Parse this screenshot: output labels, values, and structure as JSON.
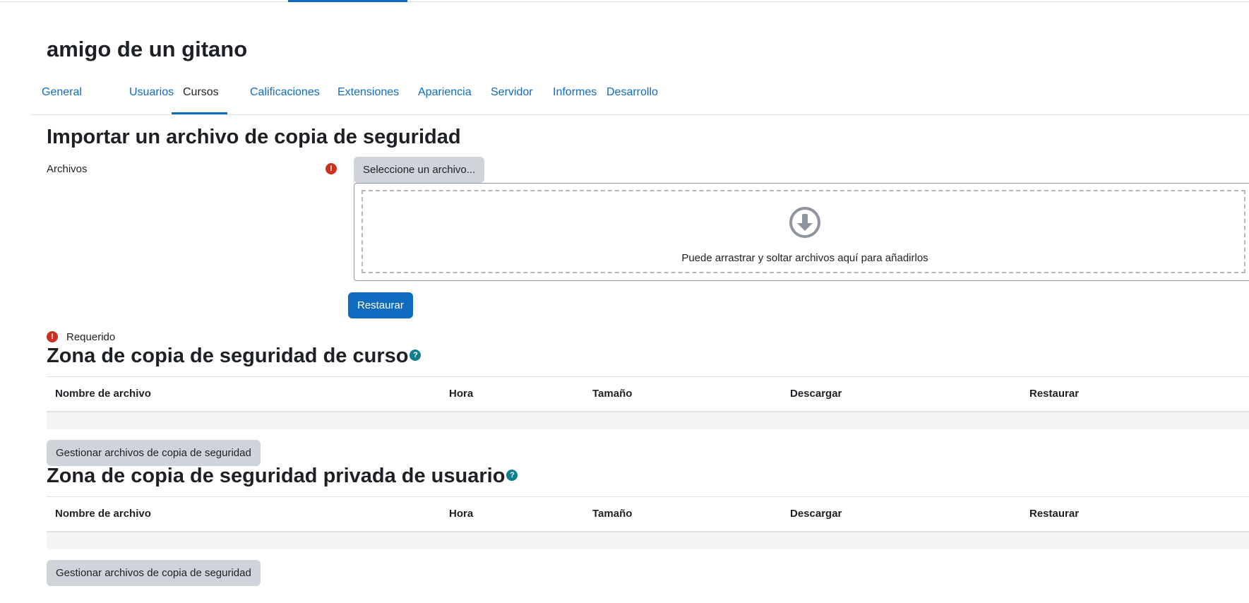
{
  "page": {
    "title": "amigo de un gitano"
  },
  "nav_tabs": [
    {
      "label": "General"
    },
    {
      "label": "Usuarios"
    },
    {
      "label": "Cursos"
    },
    {
      "label": "Calificaciones"
    },
    {
      "label": "Extensiones"
    },
    {
      "label": "Apariencia"
    },
    {
      "label": "Servidor"
    },
    {
      "label": "Informes"
    },
    {
      "label": "Desarrollo"
    }
  ],
  "active_tab": "Cursos",
  "import": {
    "heading": "Importar un archivo de copia de seguridad",
    "files_label": "Archivos",
    "required_icon": "!",
    "choose_button": "Seleccione un archivo...",
    "drop_text": "Puede arrastrar y soltar archivos aquí para añadirlos",
    "restore_button": "Restaurar",
    "required_text": "Requerido"
  },
  "course_zone": {
    "heading": "Zona de copia de seguridad de curso",
    "help_icon": "?",
    "columns": [
      "Nombre de archivo",
      "Hora",
      "Tamaño",
      "Descargar",
      "Restaurar"
    ],
    "rows": [],
    "manage_button": "Gestionar archivos de copia de seguridad"
  },
  "user_zone": {
    "heading": "Zona de copia de seguridad privada de usuario",
    "help_icon": "?",
    "columns": [
      "Nombre de archivo",
      "Hora",
      "Tamaño",
      "Descargar",
      "Restaurar"
    ],
    "rows": [],
    "manage_button": "Gestionar archivos de copia de seguridad"
  },
  "colors": {
    "link": "#0f6cbf",
    "required": "#ca3120",
    "help": "#0f7f8e",
    "secondary_button": "#ced4da"
  }
}
